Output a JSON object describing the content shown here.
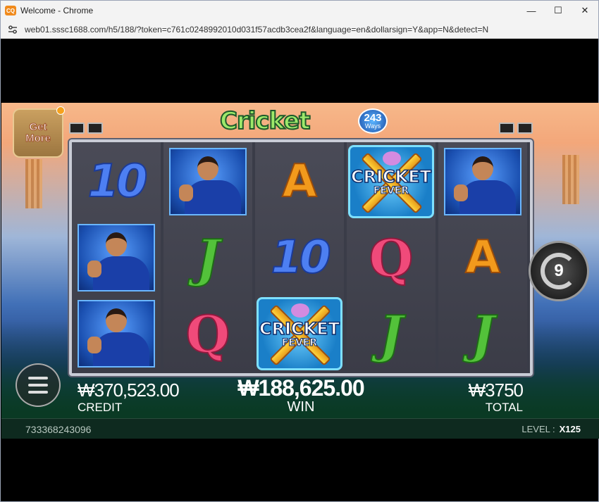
{
  "window": {
    "title": "Welcome - Chrome",
    "app_icon": "CQ",
    "controls": {
      "minimize": "—",
      "maximize": "☐",
      "close": "✕"
    }
  },
  "urlbar": {
    "url": "web01.sssc1688.com/h5/188/?token=c761c0248992010d031f57acdb3cea2f&language=en&dollarsign=Y&app=N&detect=N"
  },
  "game": {
    "logo": {
      "title": "Cricket Fever",
      "ways_number": "243",
      "ways_label": "Ways"
    },
    "get_more": {
      "line1": "Get",
      "line2": "More"
    },
    "reels": [
      [
        "10",
        "player",
        "player"
      ],
      [
        "player",
        "J",
        "Q"
      ],
      [
        "A",
        "10",
        "cricket"
      ],
      [
        "cricket",
        "Q",
        "J"
      ],
      [
        "player",
        "A",
        "J"
      ]
    ],
    "cricket_symbol": {
      "word1": "CRICKET",
      "word2": "FEVER"
    },
    "spin_count": "9",
    "credit": {
      "value": "₩370,523.00",
      "label": "CREDIT"
    },
    "win": {
      "value": "₩188,625.00",
      "label": "WIN"
    },
    "total": {
      "value": "₩3750",
      "label": "TOTAL"
    },
    "footer": {
      "player_id": "733368243096",
      "level_label": "LEVEL :",
      "level_value": "X125"
    }
  }
}
